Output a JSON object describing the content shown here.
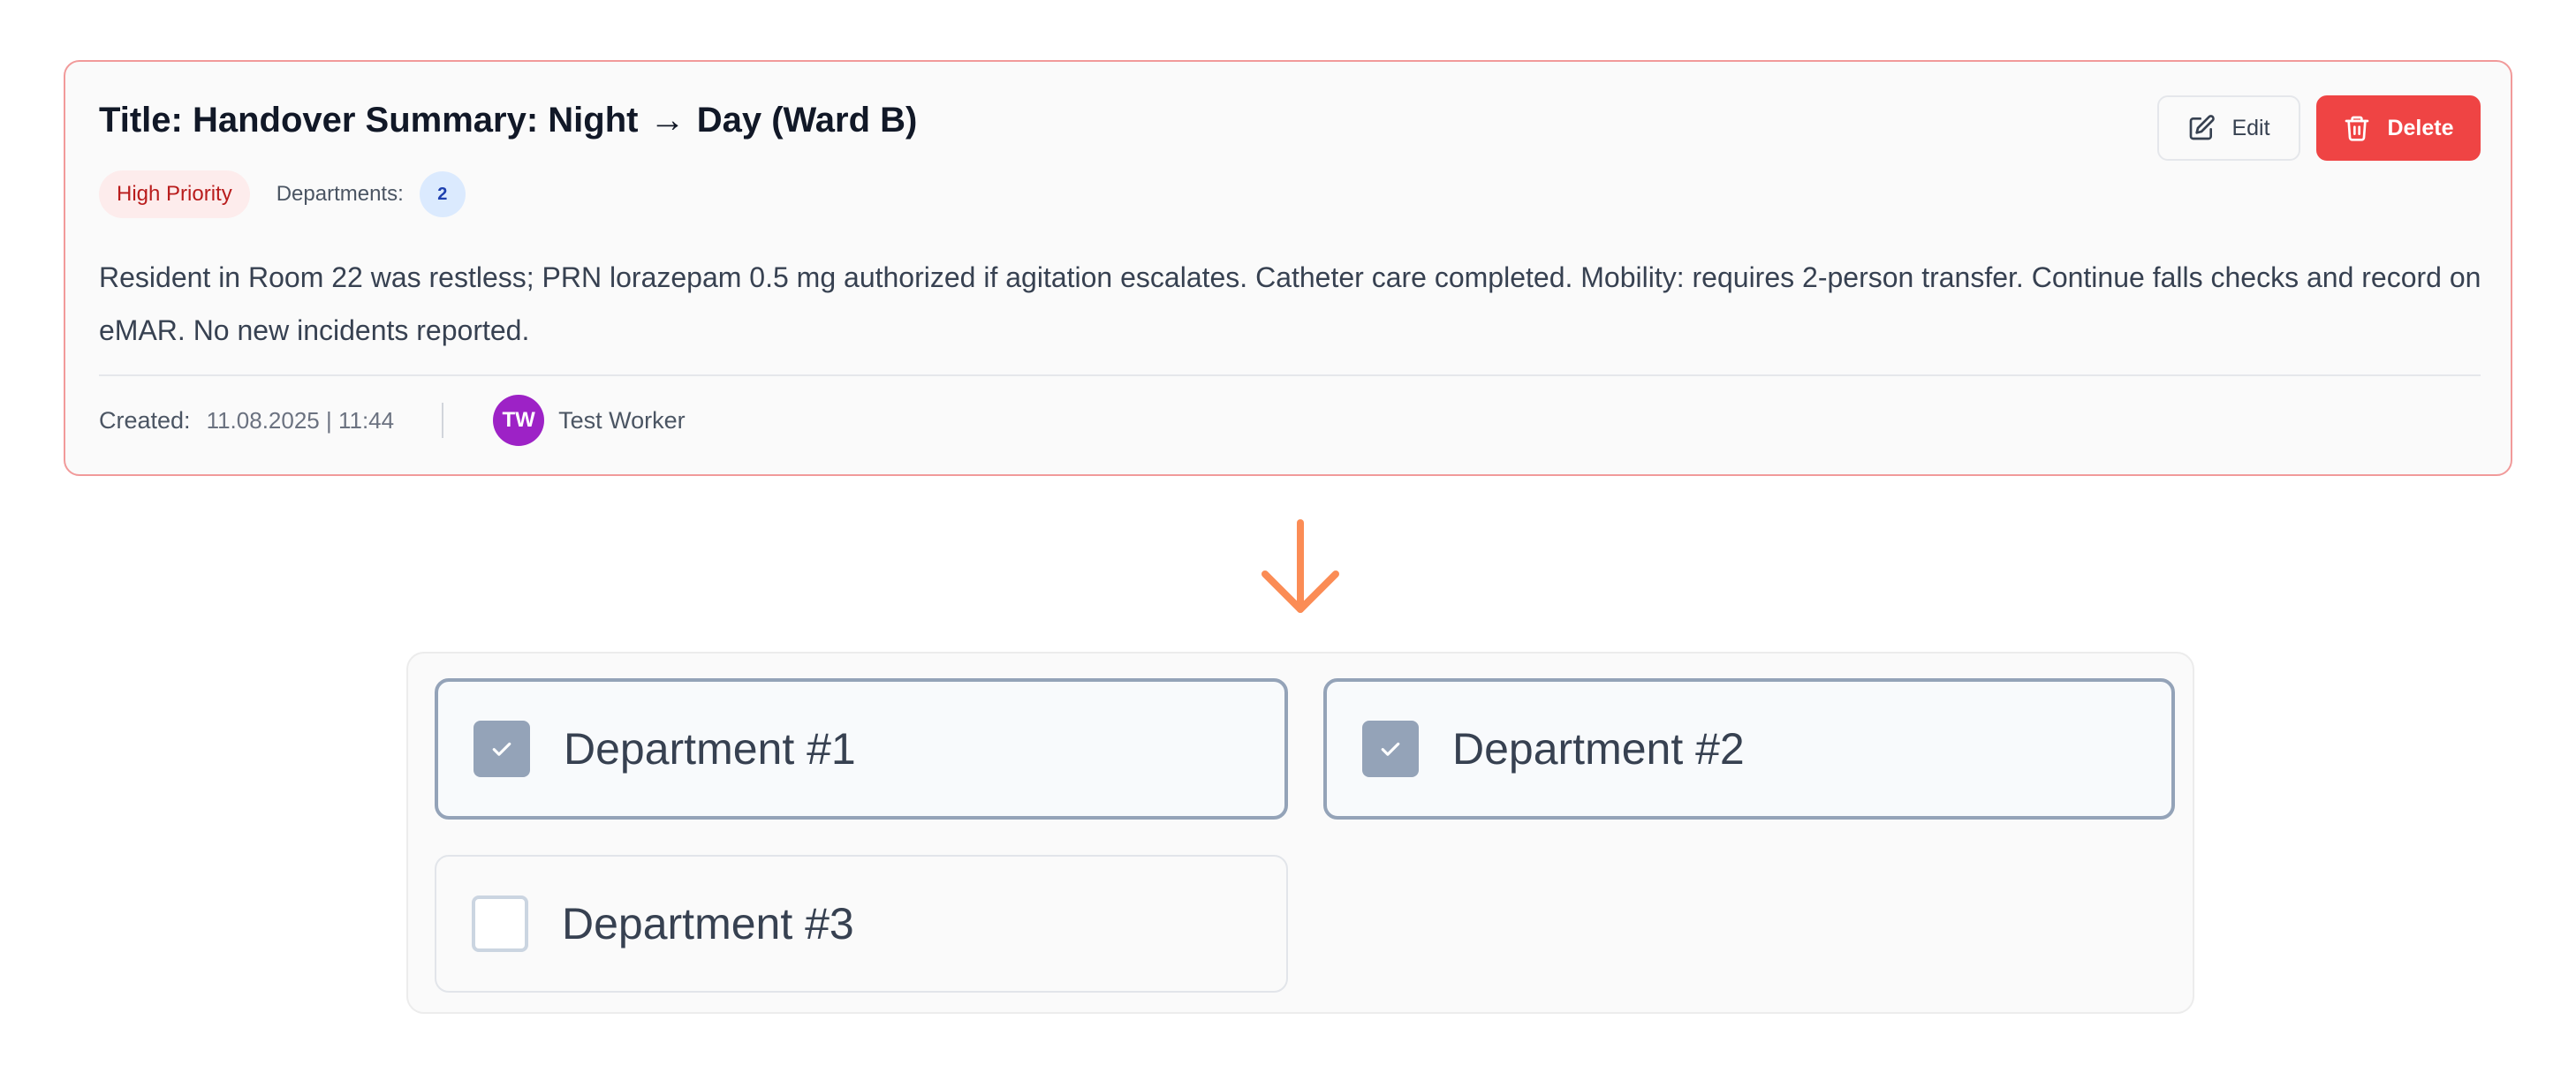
{
  "note": {
    "title_prefix": "Title: Handover Summary: Night",
    "title_arrow": "→",
    "title_suffix": "Day (Ward B)",
    "edit_label": "Edit",
    "delete_label": "Delete",
    "priority": "High Priority",
    "departments_label": "Departments:",
    "departments_count": "2",
    "body": "Resident in Room 22 was restless; PRN lorazepam 0.5 mg authorized if agitation escalates. Catheter care completed. Mobility: requires 2-person transfer. Continue falls checks and record on eMAR. No new incidents reported.",
    "created_label": "Created:",
    "created_date": "11.08.2025 | 11:44",
    "author_initials": "TW",
    "author_name": "Test Worker"
  },
  "departments": [
    {
      "label": "Department #1",
      "checked": true
    },
    {
      "label": "Department #2",
      "checked": true
    },
    {
      "label": "Department #3",
      "checked": false
    }
  ],
  "colors": {
    "accent_red": "#ef4444",
    "card_border": "#f19a9a",
    "avatar": "#9d22c6",
    "flow_arrow": "#fb8c55",
    "checked": "#94a3b8"
  },
  "icons": {
    "edit": "pencil-square-icon",
    "delete": "trash-icon",
    "flow": "arrow-down-icon",
    "check": "check-icon"
  }
}
